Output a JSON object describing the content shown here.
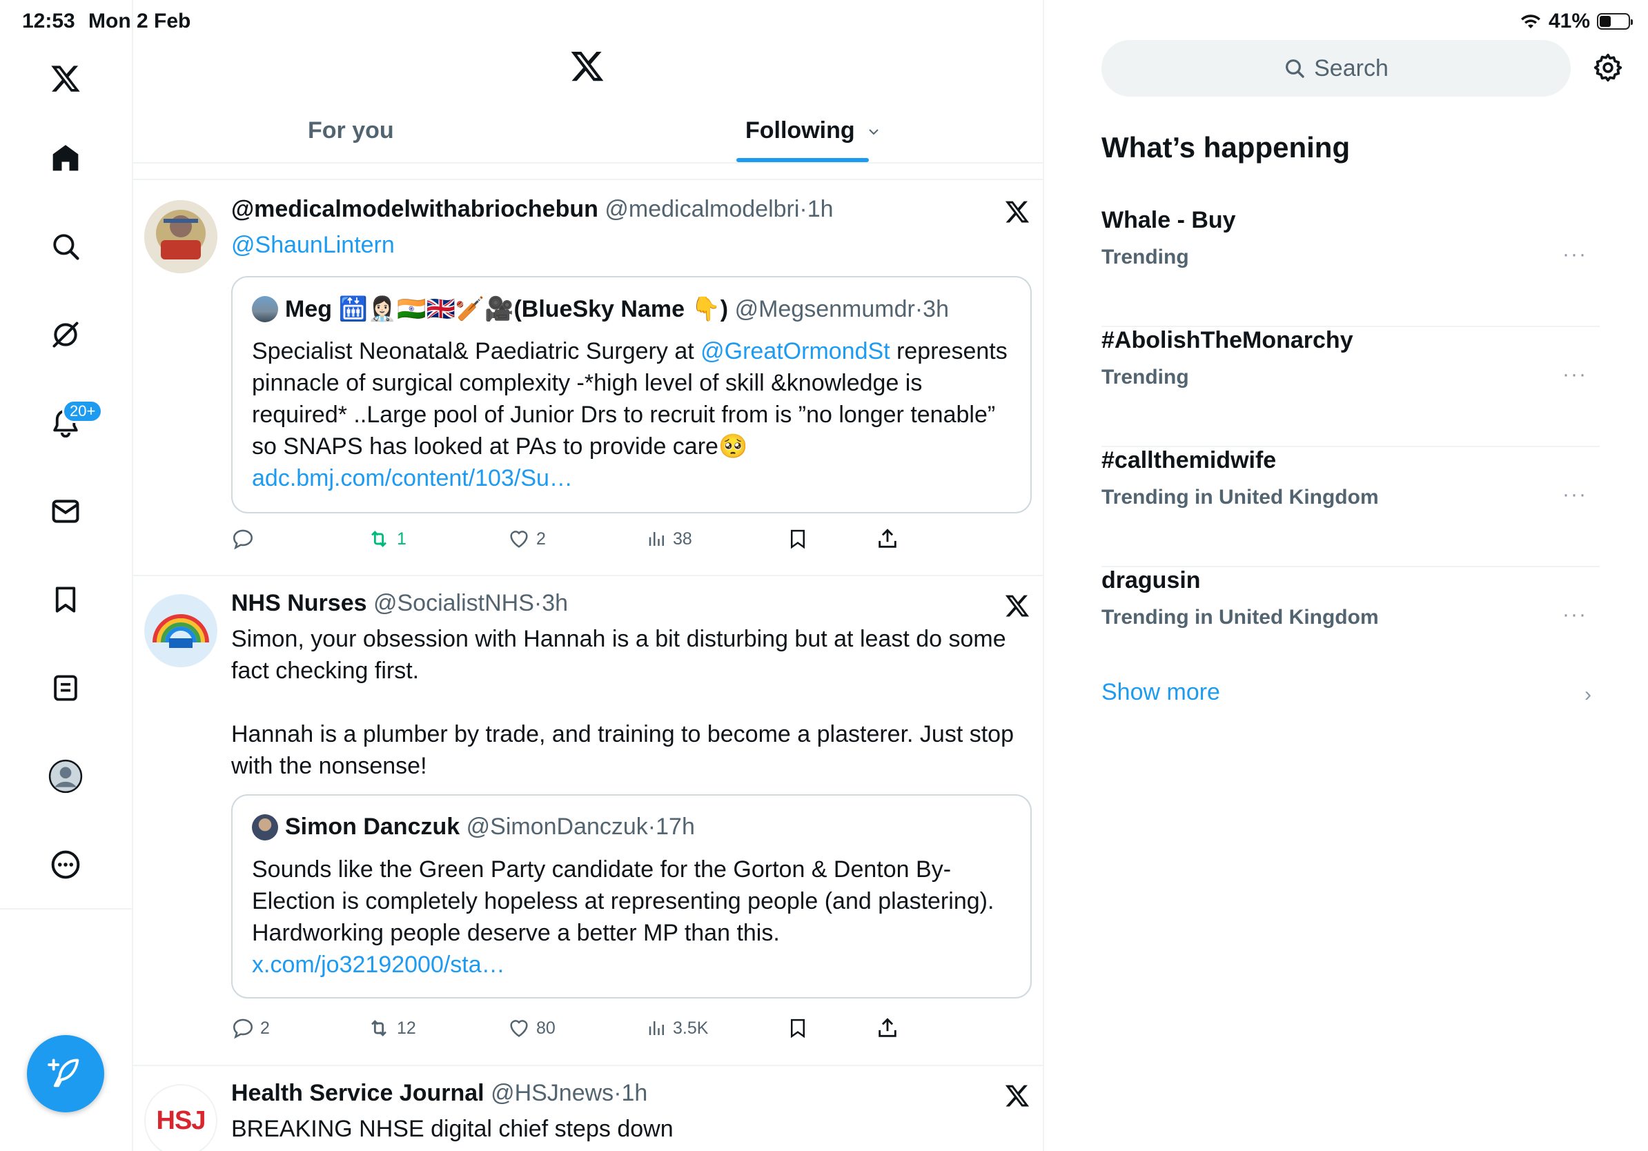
{
  "status_bar": {
    "time": "12:53",
    "date": "Mon 2 Feb",
    "battery": "41%",
    "battery_level": 0.41
  },
  "nav": {
    "notifications_badge": "20+"
  },
  "tabs": {
    "for_you": "For you",
    "following": "Following"
  },
  "tweets": [
    {
      "name": "@medicalmodelwithabriochebun",
      "handle": "@medicalmodelbri",
      "sep": "·",
      "time": "1h",
      "reply_to": "@ShaunLintern",
      "quote": {
        "name": "Meg 🛗👩🏻‍⚕️🇮🇳🇬🇧🏏🎥(BlueSky Name 👇)",
        "handle": "@Megsenmumdr",
        "sep": "·",
        "time": "3h",
        "text_1": "Specialist Neonatal& Paediatric Surgery at ",
        "mention": "@GreatOrmondSt",
        "text_2": " represents pinnacle of surgical complexity -*high level of skill &knowledge is required* ..Large pool of Junior Drs to recruit from is ”no longer tenable” so SNAPS has looked at PAs to provide care🥺",
        "link": "adc.bmj.com/content/103/Su…"
      },
      "replies": "",
      "retweets": "1",
      "likes": "2",
      "views": "38"
    },
    {
      "name": "NHS Nurses",
      "handle": "@SocialistNHS",
      "sep": "·",
      "time": "3h",
      "text_1": "Simon, your obsession with Hannah is a bit disturbing but at least do some fact checking first.",
      "text_2": "Hannah is a plumber by trade, and training to become a plasterer. Just stop with the nonsense!",
      "quote": {
        "name": "Simon Danczuk",
        "handle": "@SimonDanczuk",
        "sep": "·",
        "time": "17h",
        "text": "Sounds like the Green Party candidate for the Gorton & Denton By-Election is completely hopeless at representing people (and plastering). Hardworking people deserve a better MP than this. ",
        "link": "x.com/jo32192000/sta…"
      },
      "replies": "2",
      "retweets": "12",
      "likes": "80",
      "views": "3.5K"
    },
    {
      "name": "Health Service Journal",
      "handle": "@HSJnews",
      "sep": "·",
      "time": "1h",
      "text": "BREAKING NHSE digital chief steps down",
      "avatar_text": "HSJ"
    }
  ],
  "right": {
    "search_placeholder": "Search",
    "title": "What’s happening",
    "trends": [
      {
        "title": "Whale - Buy",
        "subtitle": "Trending"
      },
      {
        "title": "#AbolishTheMonarchy",
        "subtitle": "Trending"
      },
      {
        "title": "#callthemidwife",
        "subtitle": "Trending in United Kingdom"
      },
      {
        "title": "dragusin",
        "subtitle": "Trending in United Kingdom"
      }
    ],
    "more_glyph": "···",
    "show_more": "Show more",
    "chevron": "›"
  },
  "colors": {
    "accent": "#1d9bf0",
    "text": "#0f1419",
    "muted": "#536471",
    "retweet_green": "#00ba7c",
    "border": "#eff3f4"
  },
  "icons": [
    "x-logo",
    "home-icon",
    "search-icon",
    "grok-icon",
    "bell-icon",
    "mail-icon",
    "bookmark-icon",
    "lists-icon",
    "profile-icon",
    "more-icon",
    "compose-icon",
    "reply-icon",
    "retweet-icon",
    "like-icon",
    "views-icon",
    "share-icon",
    "gear-icon",
    "wifi-icon"
  ]
}
